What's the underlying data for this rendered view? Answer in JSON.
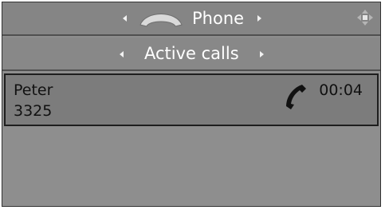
{
  "header": {
    "title": "Phone",
    "icons": {
      "title_icon": "phone-handset-icon",
      "corner_icon": "joystick-navigation-icon",
      "prev": "arrow-left-icon",
      "next": "arrow-right-icon"
    }
  },
  "subheader": {
    "title": "Active calls"
  },
  "active_call": {
    "name": "Peter",
    "number": "3325",
    "duration": "00:04",
    "icon": "phone-in-call-icon"
  },
  "colors": {
    "background": "#8e8e8e",
    "row_background": "#7c7c7c",
    "text_light": "#ffffff",
    "text_dark": "#111111"
  }
}
